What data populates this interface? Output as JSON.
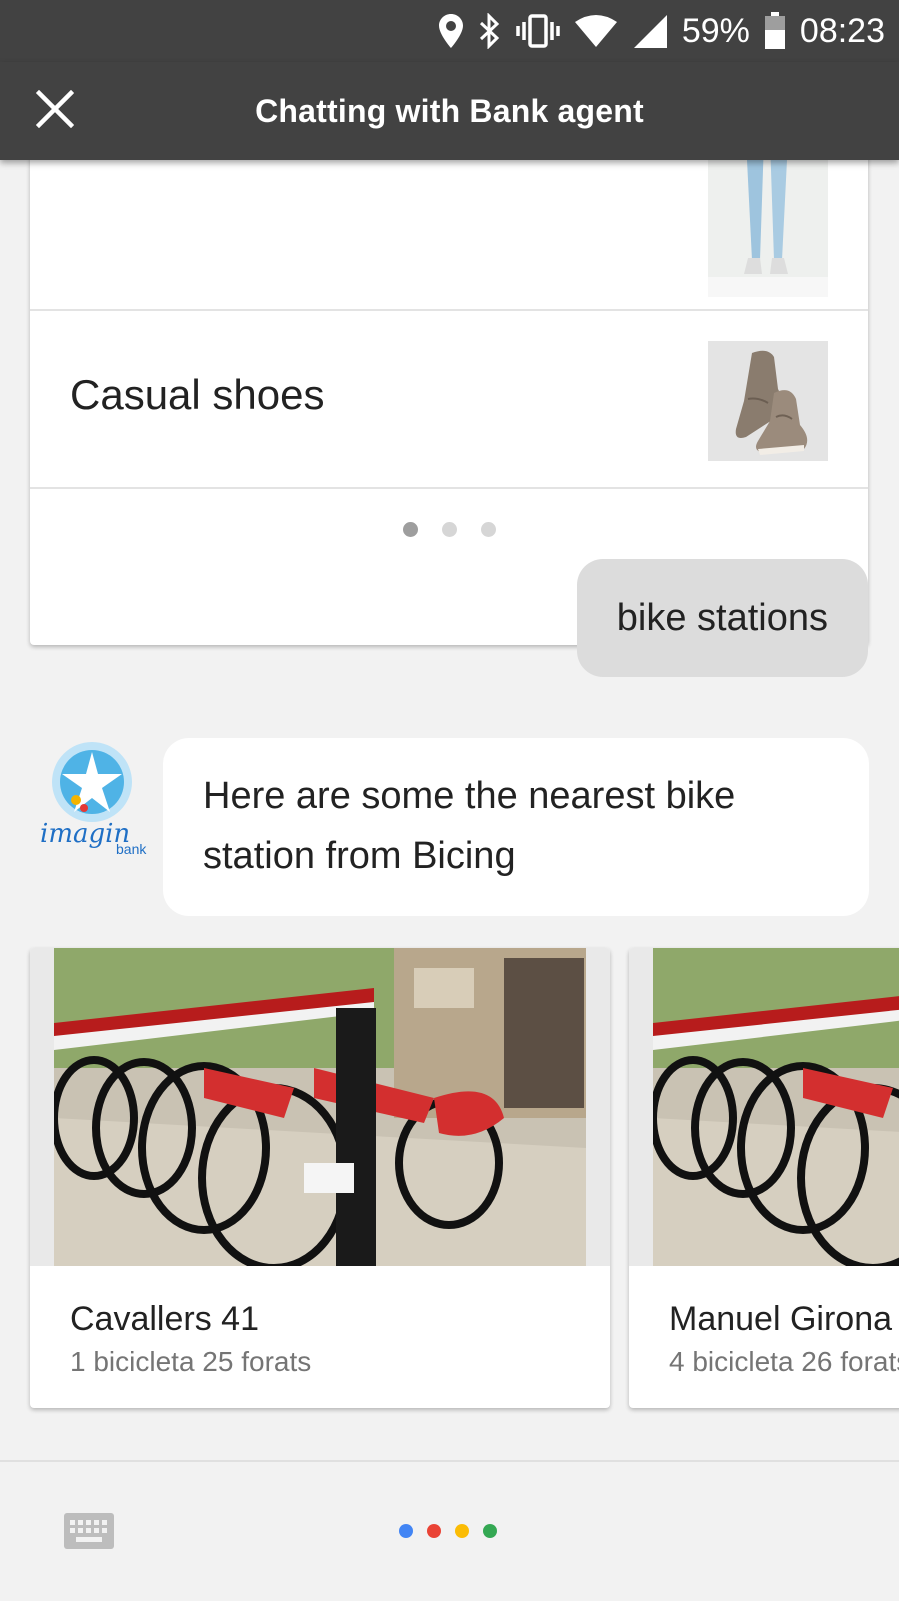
{
  "status_bar": {
    "battery": "59%",
    "time": "08:23"
  },
  "app_bar": {
    "title": "Chatting with Bank agent"
  },
  "list_card": {
    "items": [
      {
        "title": ""
      },
      {
        "title": "Casual shoes"
      }
    ],
    "pager": {
      "count": 3,
      "active": 0
    }
  },
  "messages": {
    "user": "bike stations",
    "agent": "Here are some the nearest bike station from Bicing"
  },
  "agent_logo": {
    "brand": "imagin",
    "sub": "bank"
  },
  "stations": [
    {
      "name": "Cavallers 41",
      "info": "1 bicicleta 25 forats"
    },
    {
      "name": "Manuel Girona",
      "info": "4 bicicleta 26 forats"
    }
  ],
  "assistant_colors": [
    "#4285f4",
    "#ea4335",
    "#fbbc05",
    "#34a853"
  ]
}
